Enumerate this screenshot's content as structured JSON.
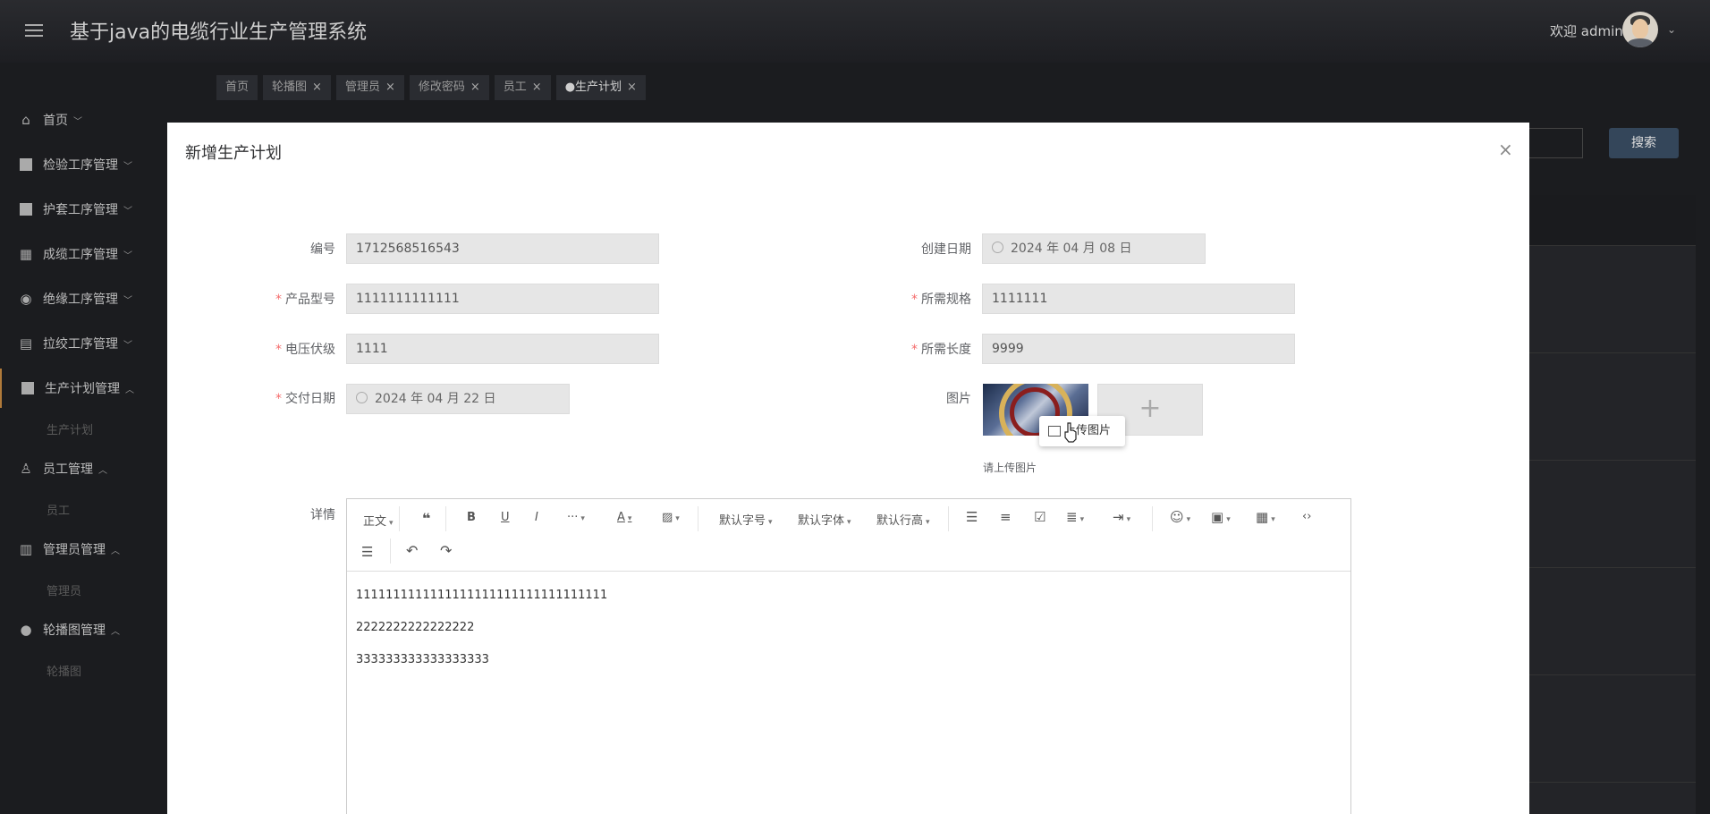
{
  "header": {
    "title": "基于java的电缆行业生产管理系统",
    "welcome": "欢迎 admin",
    "user_caret": "⌄"
  },
  "sidebar": {
    "items": [
      {
        "label": "首页",
        "icon": "home-icon"
      },
      {
        "label": "检验工序管理",
        "icon": "dashboard-icon"
      },
      {
        "label": "护套工序管理",
        "icon": "dashboard-icon"
      },
      {
        "label": "成缆工序管理",
        "icon": "grid-icon"
      },
      {
        "label": "绝缘工序管理",
        "icon": "circle-icon"
      },
      {
        "label": "拉绞工序管理",
        "icon": "layout-icon"
      },
      {
        "label": "生产计划管理",
        "icon": "dashboard-icon"
      },
      {
        "label": "员工管理",
        "icon": "user-icon"
      },
      {
        "label": "管理员管理",
        "icon": "shop-icon"
      },
      {
        "label": "轮播图管理",
        "icon": "more-icon"
      }
    ],
    "subitems": {
      "plan": "生产计划",
      "staff": "员工",
      "admin": "管理员",
      "banner": "轮播图"
    }
  },
  "tabs": [
    {
      "label": "首页",
      "closable": false
    },
    {
      "label": "轮播图",
      "closable": true
    },
    {
      "label": "管理员",
      "closable": true
    },
    {
      "label": "修改密码",
      "closable": true
    },
    {
      "label": "员工",
      "closable": true
    },
    {
      "label": "●生产计划",
      "closable": true
    }
  ],
  "background": {
    "search_button": "搜索"
  },
  "modal": {
    "title": "新增生产计划",
    "close": "×",
    "fields": {
      "code": {
        "label": "编号",
        "value": "1712568516543"
      },
      "create_date": {
        "label": "创建日期",
        "value": "2024 年 04 月 08 日"
      },
      "product_model": {
        "label": "产品型号",
        "value": "1111111111111"
      },
      "spec": {
        "label": "所需规格",
        "value": "1111111"
      },
      "voltage": {
        "label": "电压伏级",
        "value": "1111"
      },
      "length": {
        "label": "所需长度",
        "value": "9999"
      },
      "delivery_date": {
        "label": "交付日期",
        "value": "2024 年 04 月 22 日"
      },
      "image": {
        "label": "图片",
        "tip": "请上传图片"
      },
      "detail": {
        "label": "详情"
      }
    },
    "required_mark": "*",
    "upload_plus": "+",
    "editor": {
      "toolbar": {
        "paragraph": "正文",
        "font_size": "默认字号",
        "font_family": "默认字体",
        "line_height": "默认行高"
      },
      "lines": [
        "1111111111111111111111111111111111",
        "2222222222222222",
        "333333333333333333"
      ],
      "tooltip": "上传图片"
    }
  }
}
